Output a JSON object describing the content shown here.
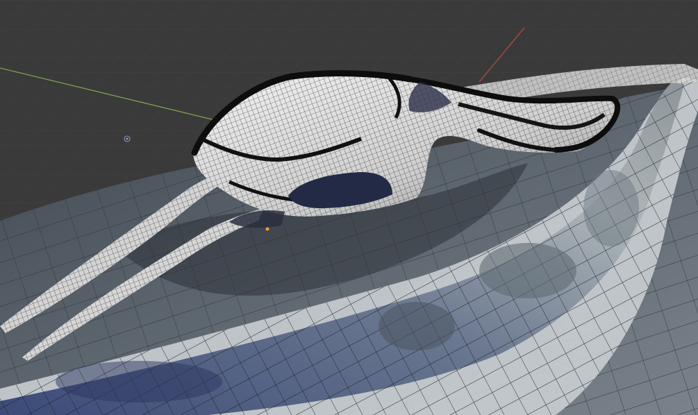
{
  "app": {
    "panel": "3d-viewport",
    "shading": "wireframe-overlay-on-material"
  },
  "colors": {
    "background": "#3a3a3a",
    "grid_line": "#4a4a4a",
    "x_axis": "#b84a3a",
    "y_axis": "#7fa34a",
    "mesh_wire": "#111111",
    "floor_surface": "#5d6670",
    "floor_reflection": "#3d4a6a",
    "shell_surface": "#e6e6e6"
  },
  "objects": [
    {
      "name": "ground-surface",
      "type": "mesh"
    },
    {
      "name": "curved-ribbon-path",
      "type": "mesh"
    },
    {
      "name": "sculpted-shell",
      "type": "mesh"
    }
  ],
  "gizmos": [
    {
      "name": "light-origin-icon"
    },
    {
      "name": "object-origin-dot"
    }
  ]
}
